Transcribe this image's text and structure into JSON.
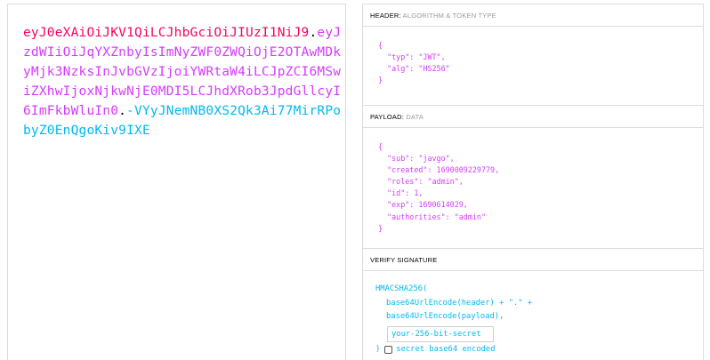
{
  "encoded": {
    "header_part": "eyJ0eXAiOiJKV1QiLCJhbGciOiJIUzI1NiJ9",
    "dot1": ".",
    "payload_part": "eyJzdWIiOiJqYXZnbyIsImNyZWF0ZWQiOjE2OTAwMDkyMjk3NzksInJvbGVzIjoiYWRtaW4iLCJpZCI6MSwiZXhwIjoxNjkwNjE0MDI5LCJhdXRob3JpdGllcyI6ImFkbWluIn0",
    "dot2": ".",
    "signature_part": "-VYyJNemNB0XS2Qk3Ai77MirRPobyZ0EnQgoKiv9IXE"
  },
  "header_section": {
    "title": "HEADER:",
    "subtitle": "ALGORITHM & TOKEN TYPE",
    "open_brace": "{",
    "lines": [
      "  \"typ\": \"JWT\",",
      "  \"alg\": \"HS256\""
    ],
    "close_brace": "}"
  },
  "payload_section": {
    "title": "PAYLOAD:",
    "subtitle": "DATA",
    "open_brace": "{",
    "lines": [
      "  \"sub\": \"javgo\",",
      "  \"created\": 1690009229779,",
      "  \"roles\": \"admin\",",
      "  \"id\": 1,",
      "  \"exp\": 1690614029,",
      "  \"authorities\": \"admin\""
    ],
    "close_brace": "}"
  },
  "verify_section": {
    "title": "VERIFY SIGNATURE",
    "func_open": "HMACSHA256(",
    "line1": "base64UrlEncode(header) + \".\" +",
    "line2": "base64UrlEncode(payload),",
    "secret_placeholder": "your-256-bit-secret",
    "close_paren": ")",
    "checkbox_label": "secret base64 encoded",
    "checkbox_checked": false
  }
}
